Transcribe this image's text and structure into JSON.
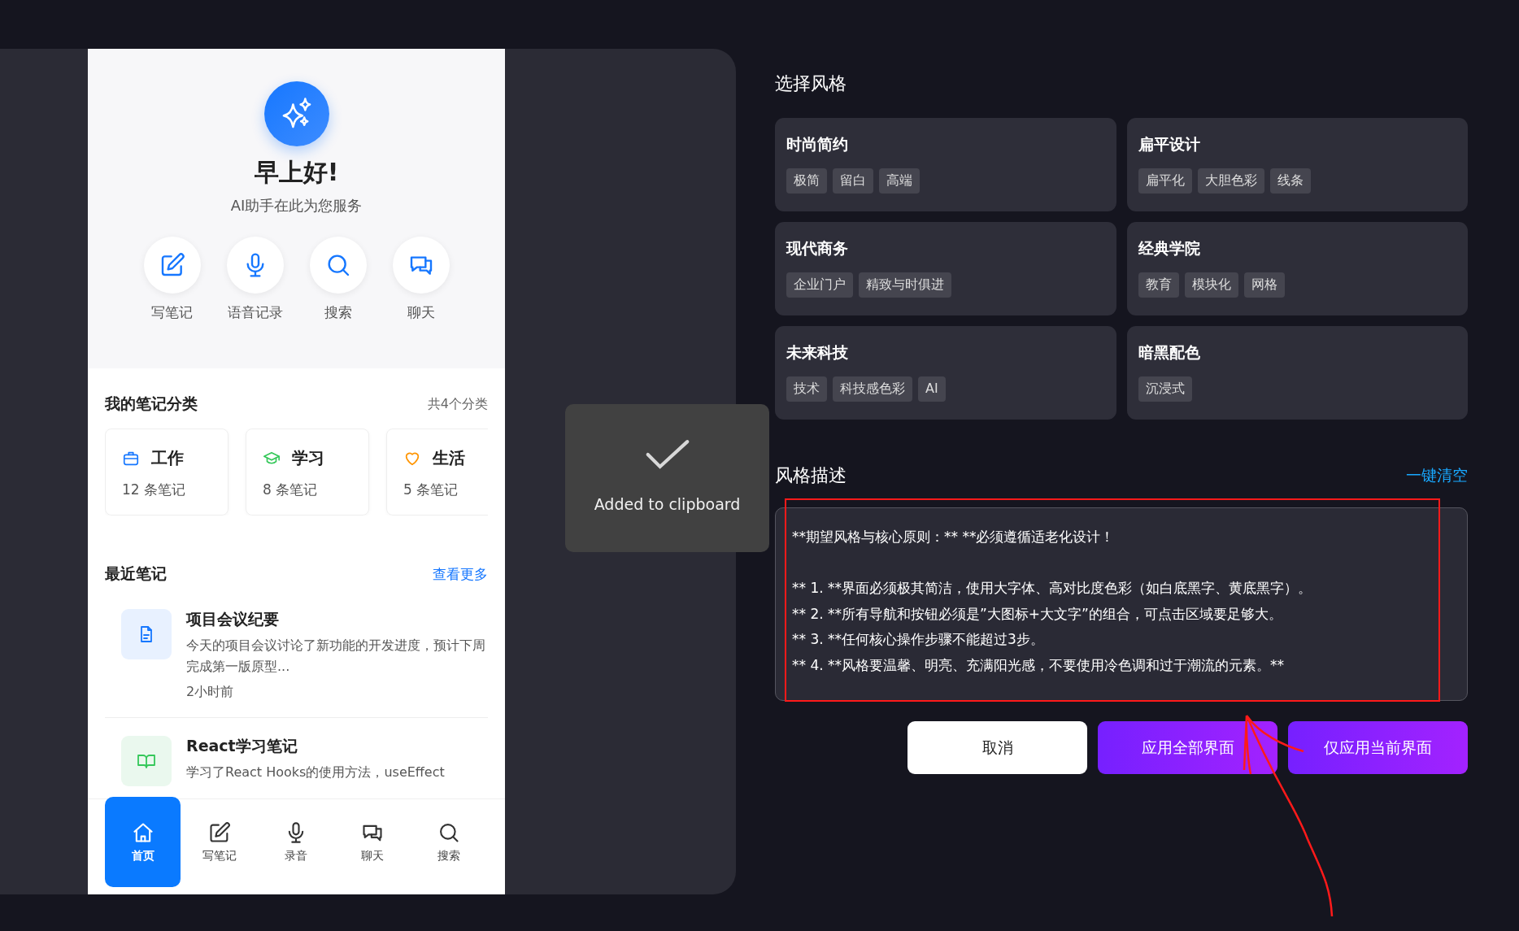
{
  "preview": {
    "greeting": "早上好!",
    "subtitle": "AI助手在此为您服务",
    "quick_actions": [
      {
        "label": "写笔记",
        "kind": "write"
      },
      {
        "label": "语音记录",
        "kind": "voice"
      },
      {
        "label": "搜索",
        "kind": "search"
      },
      {
        "label": "聊天",
        "kind": "chat"
      }
    ],
    "categories_title": "我的笔记分类",
    "categories_count": "共4个分类",
    "categories": [
      {
        "name": "工作",
        "count": "12 条笔记",
        "kind": "work",
        "color": "#1677ff"
      },
      {
        "name": "学习",
        "count": "8 条笔记",
        "kind": "study",
        "color": "#34c759"
      },
      {
        "name": "生活",
        "count": "5 条笔记",
        "kind": "life",
        "color": "#ff9500"
      }
    ],
    "recent_title": "最近笔记",
    "recent_more": "查看更多",
    "notes": [
      {
        "title": "项目会议纪要",
        "summary": "今天的项目会议讨论了新功能的开发进度，预计下周完成第一版原型...",
        "time": "2小时前",
        "kind": "doc"
      },
      {
        "title": "React学习笔记",
        "summary": "学习了React Hooks的使用方法，useEffect",
        "kind": "book"
      }
    ],
    "nav": [
      {
        "label": "首页",
        "kind": "home",
        "selected": true
      },
      {
        "label": "写笔记",
        "kind": "write",
        "selected": false
      },
      {
        "label": "录音",
        "kind": "voice",
        "selected": false
      },
      {
        "label": "聊天",
        "kind": "chat",
        "selected": false
      },
      {
        "label": "搜索",
        "kind": "search",
        "selected": false
      }
    ]
  },
  "toast": {
    "text": "Added to clipboard"
  },
  "style_title": "选择风格",
  "styles": [
    {
      "name": "时尚简约",
      "tags": [
        "极简",
        "留白",
        "高端"
      ]
    },
    {
      "name": "扁平设计",
      "tags": [
        "扁平化",
        "大胆色彩",
        "线条"
      ]
    },
    {
      "name": "现代商务",
      "tags": [
        "企业门户",
        "精致与时俱进"
      ]
    },
    {
      "name": "经典学院",
      "tags": [
        "教育",
        "模块化",
        "网格"
      ]
    },
    {
      "name": "未来科技",
      "tags": [
        "技术",
        "科技感色彩",
        "AI"
      ]
    },
    {
      "name": "暗黑配色",
      "tags": [
        "沉浸式"
      ]
    }
  ],
  "description": {
    "title": "风格描述",
    "clear": "一键清空",
    "value": "**期望风格与核心原则：** **必须遵循适老化设计！\n\n** 1. **界面必须极其简洁，使用大字体、高对比度色彩（如白底黑字、黄底黑字）。\n** 2. **所有导航和按钮必须是”大图标+大文字”的组合，可点击区域要足够大。\n** 3. **任何核心操作步骤不能超过3步。\n** 4. **风格要温馨、明亮、充满阳光感，不要使用冷色调和过于潮流的元素。**"
  },
  "buttons": [
    {
      "label": "取消",
      "kind": "secondary"
    },
    {
      "label": "应用全部界面",
      "kind": "primary"
    },
    {
      "label": "仅应用当前界面",
      "kind": "primary"
    }
  ]
}
